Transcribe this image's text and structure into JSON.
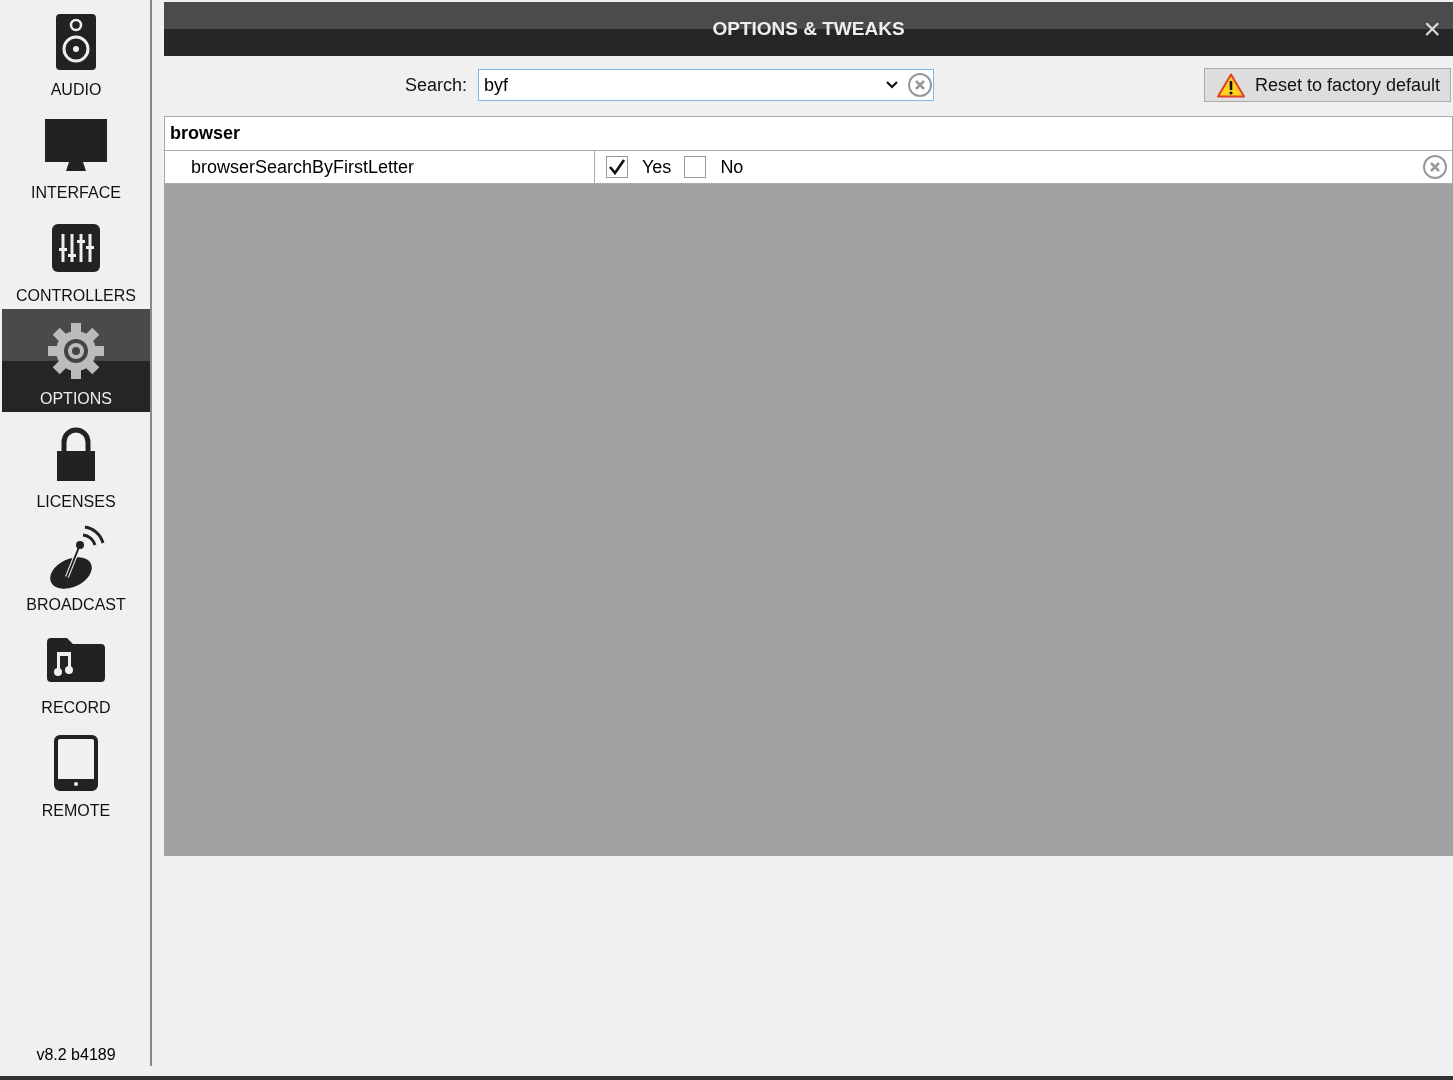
{
  "sidebar": {
    "items": [
      {
        "kind": "speaker",
        "label": "AUDIO",
        "selected": false
      },
      {
        "kind": "monitor",
        "label": "INTERFACE",
        "selected": false
      },
      {
        "kind": "mixer",
        "label": "CONTROLLERS",
        "selected": false
      },
      {
        "kind": "gear",
        "label": "OPTIONS",
        "selected": true
      },
      {
        "kind": "lock",
        "label": "LICENSES",
        "selected": false
      },
      {
        "kind": "dish",
        "label": "BROADCAST",
        "selected": false
      },
      {
        "kind": "folder",
        "label": "RECORD",
        "selected": false
      },
      {
        "kind": "tablet",
        "label": "REMOTE",
        "selected": false
      }
    ],
    "version": "v8.2 b4189"
  },
  "window": {
    "title": "OPTIONS & TWEAKS",
    "close": "×"
  },
  "search": {
    "label": "Search:",
    "value": "byf"
  },
  "reset_button": "Reset to factory default",
  "groups": [
    {
      "name": "browser",
      "settings": [
        {
          "name": "browserSearchByFirstLetter",
          "options": [
            {
              "label": "Yes",
              "checked": true
            },
            {
              "label": "No",
              "checked": false
            }
          ]
        }
      ]
    }
  ]
}
